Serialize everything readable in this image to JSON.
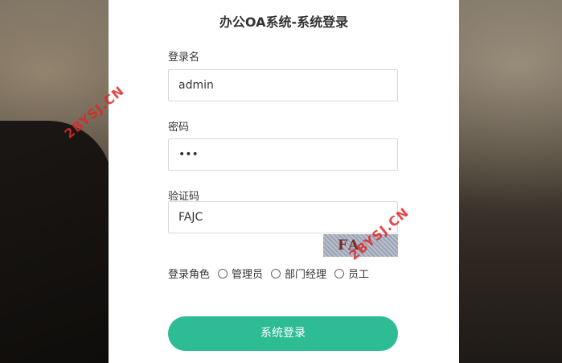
{
  "title": "办公OA系统-系统登录",
  "username": {
    "label": "登录名",
    "value": "admin"
  },
  "password": {
    "label": "密码",
    "value": "•••"
  },
  "captcha": {
    "label": "验证码",
    "value": "FAJC",
    "image_text": "FA"
  },
  "role": {
    "label": "登录角色",
    "options": [
      "管理员",
      "部门经理",
      "员工"
    ]
  },
  "login_button": "系统登录",
  "watermark": "2BYSJ.CN",
  "colors": {
    "accent": "#2ebc94",
    "watermark": "#dc2828"
  }
}
